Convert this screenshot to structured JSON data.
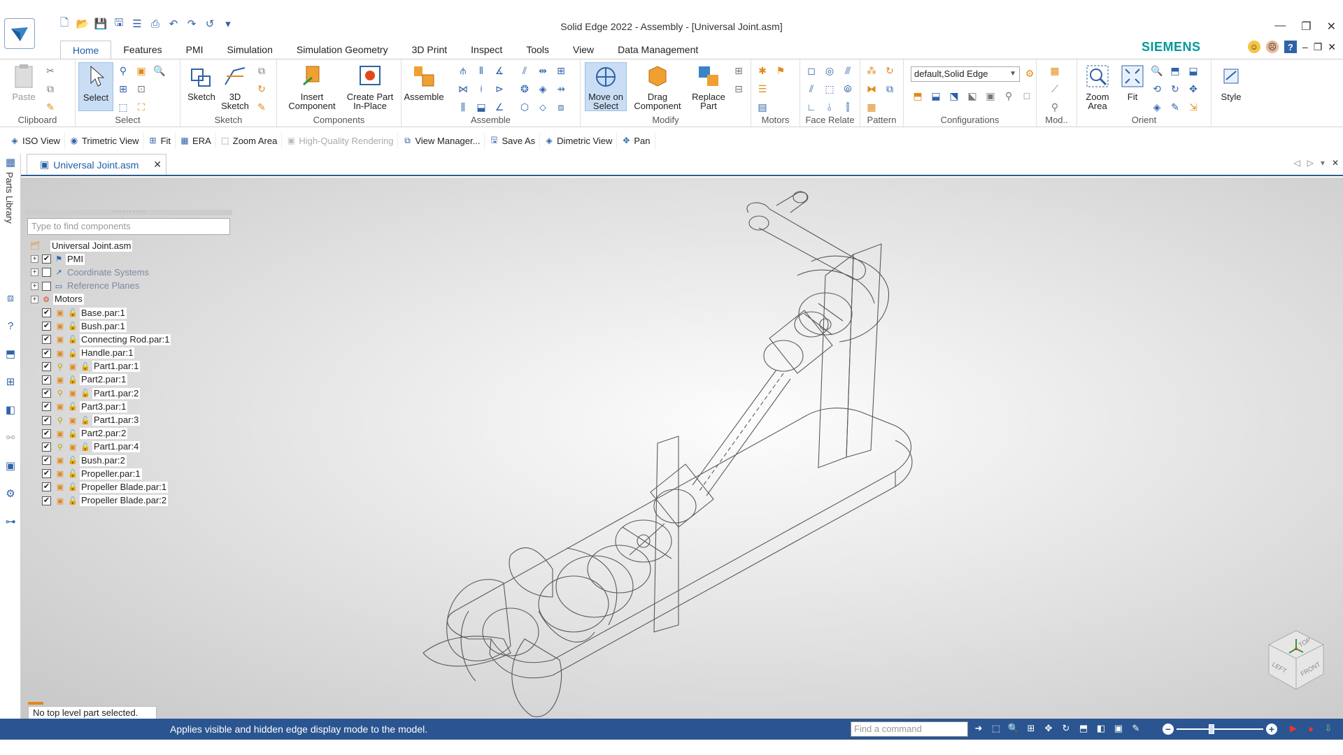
{
  "window": {
    "title": "Solid Edge 2022 - Assembly - [Universal Joint.asm]",
    "brand": "SIEMENS"
  },
  "qat_icons": [
    "new-icon",
    "open-icon",
    "save-icon",
    "save-all-icon",
    "properties-icon",
    "print-icon",
    "undo-icon",
    "redo-icon",
    "repeat-icon",
    "customize-icon"
  ],
  "tabs": [
    {
      "label": "Home",
      "active": true
    },
    {
      "label": "Features"
    },
    {
      "label": "PMI"
    },
    {
      "label": "Simulation"
    },
    {
      "label": "Simulation Geometry"
    },
    {
      "label": "3D Print"
    },
    {
      "label": "Inspect"
    },
    {
      "label": "Tools"
    },
    {
      "label": "View"
    },
    {
      "label": "Data Management"
    }
  ],
  "ribbon": {
    "clipboard": {
      "label": "Clipboard",
      "paste": "Paste"
    },
    "select": {
      "label": "Select",
      "select": "Select"
    },
    "sketch": {
      "label": "Sketch",
      "sketch": "Sketch",
      "sketch3d_a": "3D",
      "sketch3d_b": "Sketch"
    },
    "components": {
      "label": "Components",
      "insert_a": "Insert",
      "insert_b": "Component",
      "create_a": "Create Part",
      "create_b": "In-Place"
    },
    "assemble": {
      "label": "Assemble",
      "assemble": "Assemble"
    },
    "modify": {
      "label": "Modify",
      "move_a": "Move on",
      "move_b": "Select",
      "drag_a": "Drag",
      "drag_b": "Component",
      "replace_a": "Replace",
      "replace_b": "Part"
    },
    "motors": {
      "label": "Motors"
    },
    "face_relate": {
      "label": "Face Relate"
    },
    "pattern": {
      "label": "Pattern"
    },
    "configurations": {
      "label": "Configurations",
      "value": "default,Solid Edge"
    },
    "mod": {
      "label": "Mod.."
    },
    "orient": {
      "label": "Orient",
      "zoom_a": "Zoom",
      "zoom_b": "Area",
      "fit": "Fit"
    },
    "style": {
      "label": "Style"
    }
  },
  "command_bar": [
    {
      "label": "ISO View",
      "icon": "iso-view-icon"
    },
    {
      "label": "Trimetric View",
      "icon": "trimetric-view-icon"
    },
    {
      "label": "Fit",
      "icon": "fit-icon"
    },
    {
      "label": "ERA",
      "icon": "era-icon"
    },
    {
      "label": "Zoom Area",
      "icon": "zoom-area-icon"
    },
    {
      "label": "High-Quality Rendering",
      "icon": "rendering-icon",
      "disabled": true
    },
    {
      "label": "View Manager...",
      "icon": "view-manager-icon"
    },
    {
      "label": "Save As",
      "icon": "save-as-icon"
    },
    {
      "label": "Dimetric View",
      "icon": "dimetric-view-icon"
    },
    {
      "label": "Pan",
      "icon": "pan-icon"
    }
  ],
  "sidebar": {
    "parts_library": "Parts Library"
  },
  "document_tab": {
    "label": "Universal Joint.asm"
  },
  "pathfinder": {
    "search_placeholder": "Type to find components",
    "items": [
      {
        "label": "Universal Joint.asm",
        "level": 0,
        "kind": "assembly"
      },
      {
        "label": "PMI",
        "level": 1,
        "kind": "pmi",
        "expand": true,
        "checked": true
      },
      {
        "label": "Coordinate Systems",
        "level": 1,
        "kind": "coord",
        "expand": true,
        "checked": false,
        "grey": true
      },
      {
        "label": "Reference Planes",
        "level": 1,
        "kind": "planes",
        "expand": true,
        "checked": false,
        "grey": true
      },
      {
        "label": "Motors",
        "level": 1,
        "kind": "motors",
        "expand": true,
        "nocheck": true
      },
      {
        "label": "Base.par:1",
        "level": 2,
        "kind": "part",
        "checked": true
      },
      {
        "label": "Bush.par:1",
        "level": 2,
        "kind": "part",
        "checked": true
      },
      {
        "label": "Connecting Rod.par:1",
        "level": 2,
        "kind": "part",
        "checked": true
      },
      {
        "label": "Handle.par:1",
        "level": 2,
        "kind": "part",
        "checked": true
      },
      {
        "label": "Part1.par:1",
        "level": 2,
        "kind": "part-linked",
        "checked": true
      },
      {
        "label": "Part2.par:1",
        "level": 2,
        "kind": "part",
        "checked": true
      },
      {
        "label": "Part1.par:2",
        "level": 2,
        "kind": "part-linked",
        "checked": true
      },
      {
        "label": "Part3.par:1",
        "level": 2,
        "kind": "part",
        "checked": true
      },
      {
        "label": "Part1.par:3",
        "level": 2,
        "kind": "part-linked",
        "checked": true
      },
      {
        "label": "Part2.par:2",
        "level": 2,
        "kind": "part",
        "checked": true
      },
      {
        "label": "Part1.par:4",
        "level": 2,
        "kind": "part-linked",
        "checked": true
      },
      {
        "label": "Bush.par:2",
        "level": 2,
        "kind": "part",
        "checked": true
      },
      {
        "label": "Propeller.par:1",
        "level": 2,
        "kind": "part",
        "checked": true
      },
      {
        "label": "Propeller Blade.par:1",
        "level": 2,
        "kind": "part",
        "checked": true
      },
      {
        "label": "Propeller Blade.par:2",
        "level": 2,
        "kind": "part",
        "checked": true
      }
    ],
    "status": "No top level part selected."
  },
  "viewcube": {
    "top": "TOP",
    "left": "LEFT",
    "front": "FRONT"
  },
  "statusbar": {
    "message": "Applies visible and hidden edge display mode to the model.",
    "find_placeholder": "Find a command"
  },
  "colors": {
    "accent": "#2b5591",
    "brand": "#009999",
    "selection": "#c9def5",
    "orange": "#e08a1c"
  }
}
